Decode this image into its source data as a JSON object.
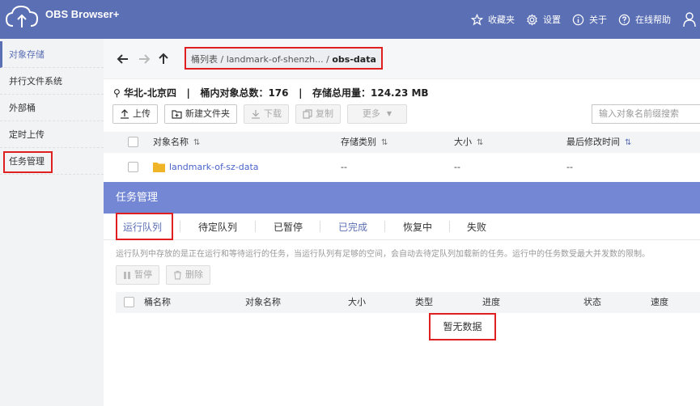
{
  "app": {
    "title": "OBS Browser+"
  },
  "topnav": [
    {
      "icon": "star-icon",
      "label": "收藏夹"
    },
    {
      "icon": "gear-icon",
      "label": "设置"
    },
    {
      "icon": "info-icon",
      "label": "关于"
    },
    {
      "icon": "help-icon",
      "label": "在线帮助"
    }
  ],
  "sidebar": {
    "items": [
      {
        "label": "对象存储",
        "active": true
      },
      {
        "label": "并行文件系统"
      },
      {
        "label": "外部桶"
      },
      {
        "label": "定时上传"
      },
      {
        "label": "任务管理"
      }
    ]
  },
  "breadcrumb": {
    "root": "桶列表",
    "sep": "/",
    "bucket": "landmark-of-shenzh...",
    "current": "obs-data"
  },
  "info": {
    "region": "华北-北京四",
    "object_count_label": "桶内对象总数：176",
    "storage_label": "存储总用量：124.23 MB",
    "divider": "|"
  },
  "toolbar": {
    "upload": "上传",
    "new_folder": "新建文件夹",
    "download": "下载",
    "copy": "复制",
    "more": "更多"
  },
  "search": {
    "placeholder": "输入对象名前缀搜索"
  },
  "table": {
    "headers": [
      "对象名称",
      "存储类别",
      "大小",
      "最后修改时间"
    ],
    "rows": [
      {
        "name": "landmark-of-sz-data",
        "storage_class": "--",
        "size": "--",
        "modified": "--"
      }
    ]
  },
  "task_manager": {
    "title": "任务管理",
    "tabs": [
      "运行队列",
      "待定队列",
      "已暂停",
      "已完成",
      "恢复中",
      "失败"
    ],
    "description": "运行队列中存放的是正在运行和等待运行的任务，当运行队列有足够的空间，会自动去待定队列加载新的任务。运行中的任务数受最大并发数的限制。",
    "pause": "暂停",
    "delete": "删除",
    "headers": [
      "桶名称",
      "对象名称",
      "大小",
      "类型",
      "进度",
      "状态",
      "速度"
    ],
    "empty": "暂无数据"
  },
  "colors": {
    "accent": "#5b6fb4",
    "panel_header": "#7487d4",
    "highlight": "#e02020"
  }
}
